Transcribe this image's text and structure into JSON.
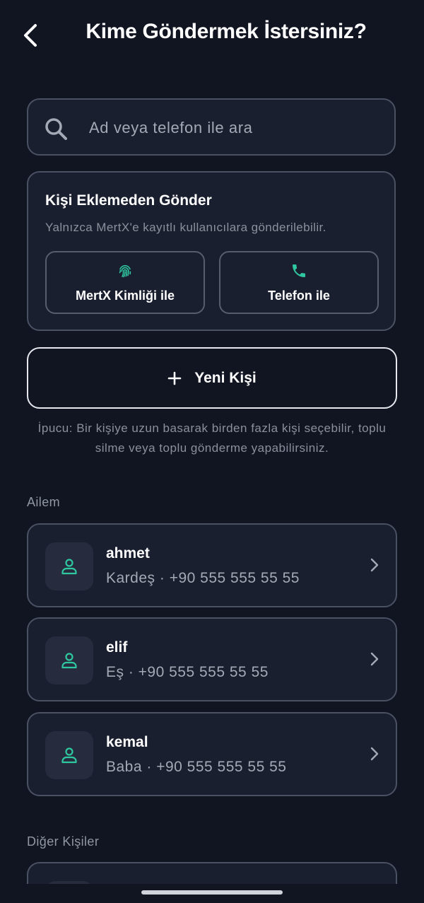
{
  "header": {
    "title": "Kime Göndermek İstersiniz?"
  },
  "search": {
    "placeholder": "Ad veya telefon ile ara"
  },
  "quick_send": {
    "title": "Kişi Eklemeden Gönder",
    "subtitle": "Yalnızca MertX'e kayıtlı kullanıcılara gönderilebilir.",
    "buttons": [
      {
        "label": "MertX Kimliği ile",
        "icon": "fingerprint-icon"
      },
      {
        "label": "Telefon ile",
        "icon": "phone-icon"
      }
    ]
  },
  "new_contact": {
    "label": "Yeni Kişi",
    "icon": "plus-icon"
  },
  "tip": "İpucu: Bir kişiye uzun basarak birden fazla kişi seçebilir, toplu silme veya toplu gönderme yapabilirsiniz.",
  "sections": [
    {
      "title": "Ailem",
      "contacts": [
        {
          "name": "ahmet",
          "detail": "Kardeş · +90 555 555 55 55"
        },
        {
          "name": "elif",
          "detail": "Eş · +90 555 555 55 55"
        },
        {
          "name": "kemal",
          "detail": "Baba · +90 555 555 55 55"
        }
      ]
    },
    {
      "title": "Diğer Kişiler",
      "contacts": []
    }
  ],
  "colors": {
    "background": "#111522",
    "card": "#1a1f2f",
    "border": "#4a5163",
    "accent": "#2fc7a0",
    "muted_text": "#8b909c"
  }
}
